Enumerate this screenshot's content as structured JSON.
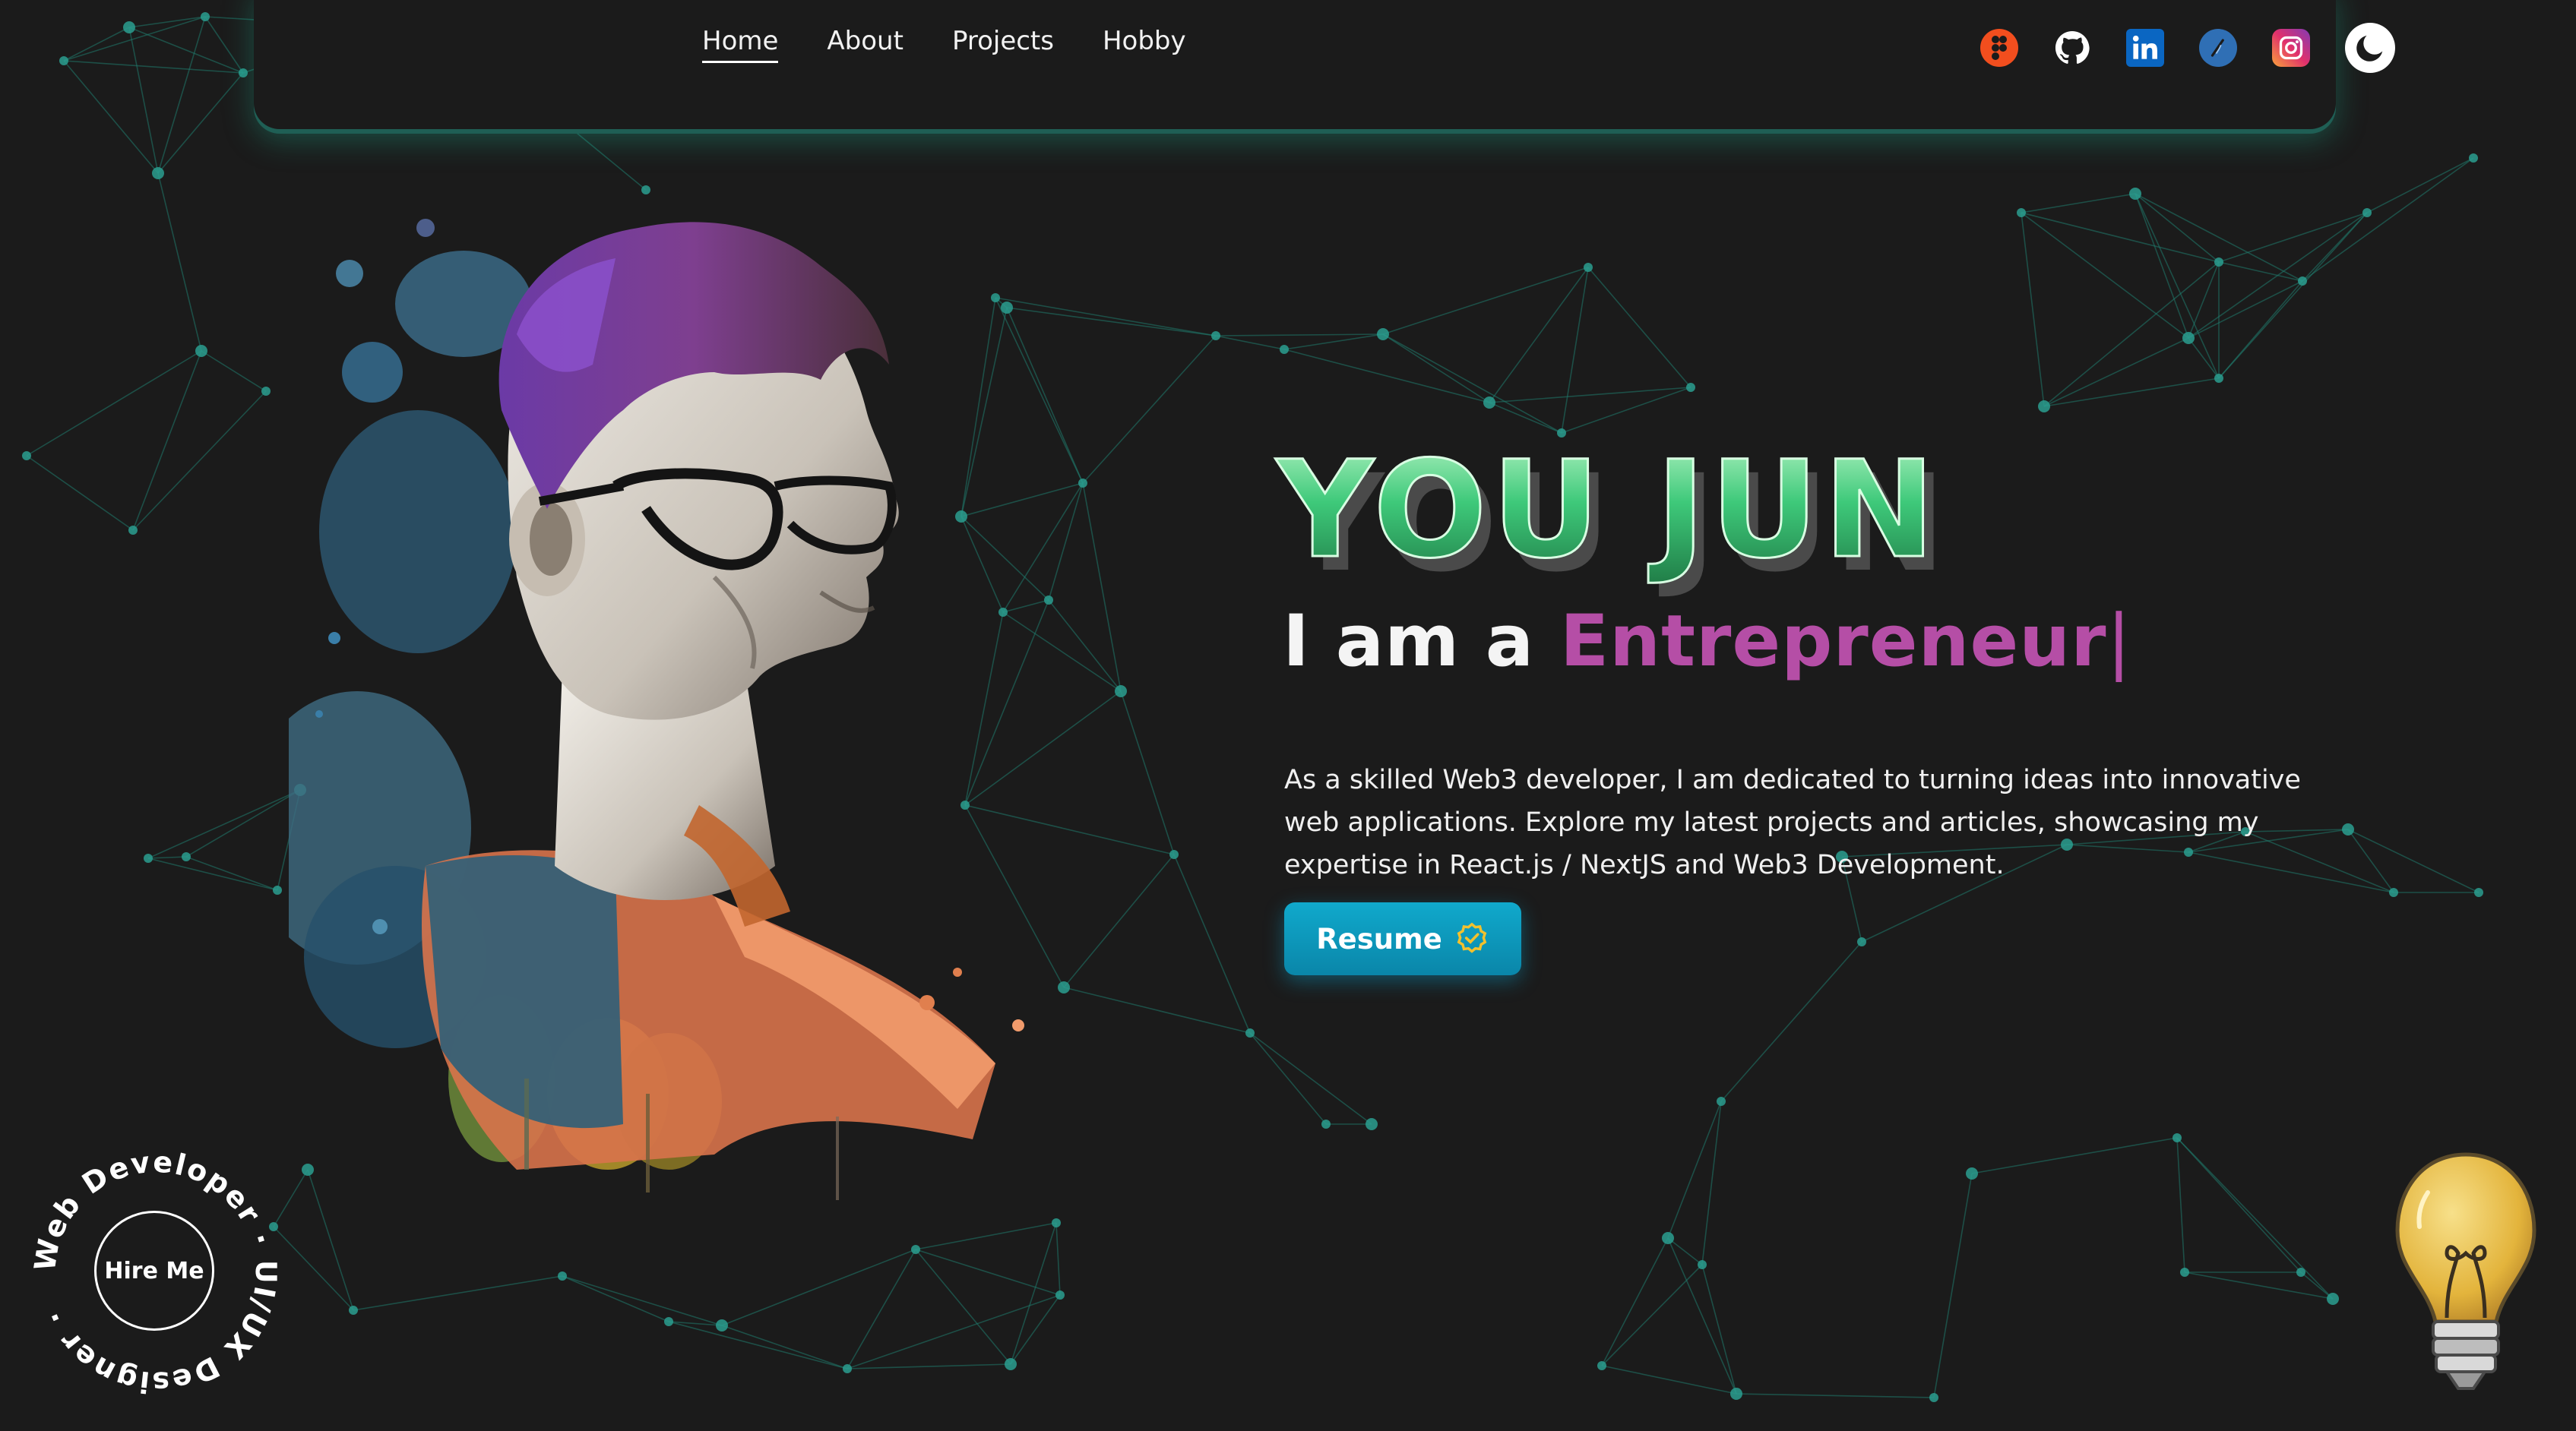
{
  "nav": {
    "links": [
      {
        "label": "Home",
        "active": true
      },
      {
        "label": "About",
        "active": false
      },
      {
        "label": "Projects",
        "active": false
      },
      {
        "label": "Hobby",
        "active": false
      }
    ],
    "socials": [
      {
        "name": "figma-icon",
        "color": "#f24e1e"
      },
      {
        "name": "github-icon",
        "color": "#ffffff"
      },
      {
        "name": "linkedin-icon",
        "color": "#0a66c2"
      },
      {
        "name": "hashnode-icon",
        "color": "#2f6fb5"
      },
      {
        "name": "instagram-icon",
        "color": "#e1306c"
      }
    ],
    "theme_toggle_icon": "moon-icon"
  },
  "hero": {
    "name": "YOU JUN",
    "headline_prefix": "I am a ",
    "headline_role": "Entrepreneur",
    "headline_cursor": "|",
    "intro": "As a skilled Web3 developer, I am dedicated to turning ideas into innovative web applications. Explore my latest projects and articles, showcasing my expertise in React.js / NextJS and Web3 Development.",
    "resume_label": "Resume",
    "resume_icon": "badge-check-icon"
  },
  "hire": {
    "button_label": "Hire Me",
    "ring_text": "Web Developer · UI/UX Designer ·"
  },
  "colors": {
    "background": "#1b1b1b",
    "accent_teal": "#1f7a6c",
    "accent_pink": "#b54ea6",
    "button_blue": "#0a9ec1",
    "name_green": "#3ec97a"
  }
}
